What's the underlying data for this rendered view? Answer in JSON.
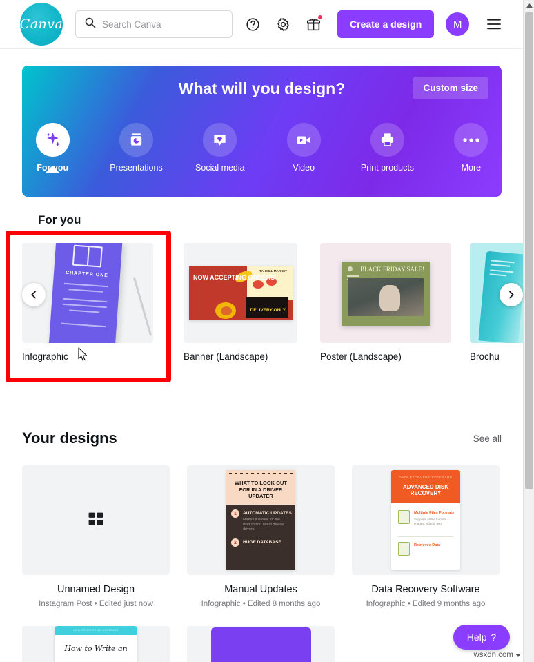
{
  "header": {
    "logo_text": "Canva",
    "logo_icon": "canva-logo-icon",
    "search": {
      "placeholder": "Search Canva",
      "value": "",
      "icon": "search-icon"
    },
    "help_icon": "question-circle-icon",
    "settings_icon": "gear-icon",
    "gift_icon": "gift-icon",
    "create_label": "Create a design",
    "avatar_initial": "M",
    "menu_icon": "hamburger-menu-icon"
  },
  "hero": {
    "title": "What will you design?",
    "custom_size_label": "Custom size",
    "categories": [
      {
        "label": "For you",
        "icon": "sparkle-icon",
        "active": true
      },
      {
        "label": "Presentations",
        "icon": "presentation-icon",
        "active": false
      },
      {
        "label": "Social media",
        "icon": "heart-bubble-icon",
        "active": false
      },
      {
        "label": "Video",
        "icon": "video-camera-icon",
        "active": false
      },
      {
        "label": "Print products",
        "icon": "printer-icon",
        "active": false
      },
      {
        "label": "More",
        "icon": "ellipsis-icon",
        "active": false
      }
    ]
  },
  "for_you": {
    "title": "For you",
    "prev_icon": "chevron-left-icon",
    "next_icon": "chevron-right-icon",
    "cards": [
      {
        "label": "Infographic",
        "art": "CHAPTER ONE",
        "highlighted": true
      },
      {
        "label": "Banner (Landscape)",
        "art": "NOW ACCEPTING ORDERS",
        "highlighted": false
      },
      {
        "label": "Poster (Landscape)",
        "art": "BLACK FRIDAY SALE!",
        "highlighted": false
      },
      {
        "label": "Brochu",
        "art": "",
        "highlighted": false
      }
    ],
    "banner_art": {
      "headline": "NOW ACCEPTING ORDERS",
      "tag": "TAHMILL MARKET",
      "badge": "DELIVERY ONLY"
    },
    "poster_art": {
      "headline": "BLACK FRIDAY SALE!"
    }
  },
  "your_designs": {
    "title": "Your designs",
    "see_all_label": "See all",
    "items": [
      {
        "name": "Unnamed Design",
        "meta": "Instagram Post • Edited just now",
        "thumb": "grid-placeholder"
      },
      {
        "name": "Manual Updates",
        "meta": "Infographic • Edited 8 months ago",
        "thumb": "driver-updater-infographic"
      },
      {
        "name": "Data Recovery Software",
        "meta": "Infographic • Edited 9 months ago",
        "thumb": "disk-recovery-infographic"
      }
    ],
    "manual_thumb": {
      "title": "WHAT TO LOOK OUT FOR IN A DRIVER UPDATER",
      "item1_num": "1",
      "item1_title": "AUTOMATIC UPDATES",
      "item1_text": "Makes it easier for the user to find latest device drivers.",
      "item2_num": "2",
      "item2_title": "HUGE DATABASE"
    },
    "drs_thumb": {
      "eyebrow": "DATA RECOVERY SOFTWARE",
      "title": "ADVANCED DISK RECOVERY",
      "row1_title": "Multiple Files Formats",
      "row1_text": "Supports all file formats - images, videos, text.",
      "row2_title": "Retrieves Data"
    },
    "row2": [
      {
        "thumb": "how-to-write-an"
      },
      {
        "thumb": "purple-blank"
      }
    ],
    "howto_thumb": {
      "eyebrow": "HOW TO WRITE AN ABSTRACT",
      "title": "How to Write an"
    }
  },
  "help": {
    "label": "Help",
    "icon": "question-mark-icon"
  },
  "watermark": {
    "text": "wsxdn.com"
  },
  "colors": {
    "brand_purple": "#8b3dff",
    "brand_teal": "#00c4cc",
    "highlight_red": "#fb0007",
    "text_dark": "#0e1318",
    "text_muted": "#7a7a80"
  }
}
